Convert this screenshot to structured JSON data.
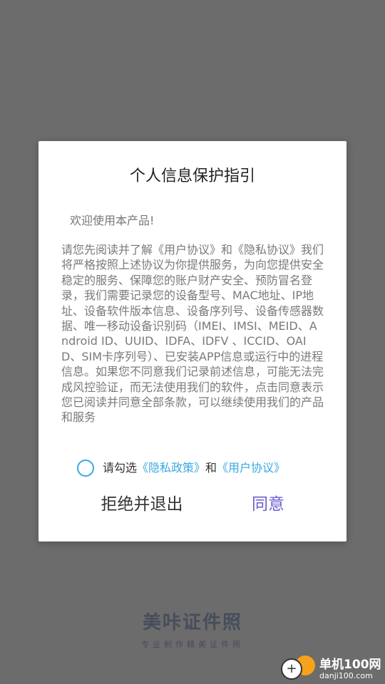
{
  "brand": {
    "name": "美咔证件照",
    "slogan": "专业制作精美证件照"
  },
  "watermark": {
    "title": "单机100网",
    "url": "danji100.com",
    "plus_glyph": "+"
  },
  "dialog": {
    "title": "个人信息保护指引",
    "welcome": "欢迎使用本产品!",
    "body": "请您先阅读并了解《用户协议》和《隐私协议》我们将严格按照上述协议为你提供服务，为向您提供安全稳定的服务、保障您的账户财产安全、预防冒名登录，我们需要记录您的设备型号、MAC地址、IP地址、设备软件版本信息、设备序列号、设备传感器数据、唯一移动设备识别码（IMEI、IMSI、MEID、Android ID、UUID、IDFA、IDFV 、ICCID、OAID、SIM卡序列号）、已安装APP信息或运行中的进程信息。如果您不同意我们记录前述信息，可能无法完成风控验证，而无法使用我们的软件，点击同意表示您已阅读并同意全部条款，可以继续使用我们的产品和服务",
    "consent": {
      "checked": false,
      "prefix": "请勾选",
      "privacy_link": "《隐私政策》",
      "conjunction": "和",
      "user_link": "《用户协议》"
    },
    "buttons": {
      "reject": "拒绝并退出",
      "agree": "同意"
    }
  },
  "colors": {
    "overlay": "#6c6c6c",
    "link": "#3aa8e0",
    "agree_button": "#6d5fd0",
    "watermark_accent": "#f7a21b"
  }
}
